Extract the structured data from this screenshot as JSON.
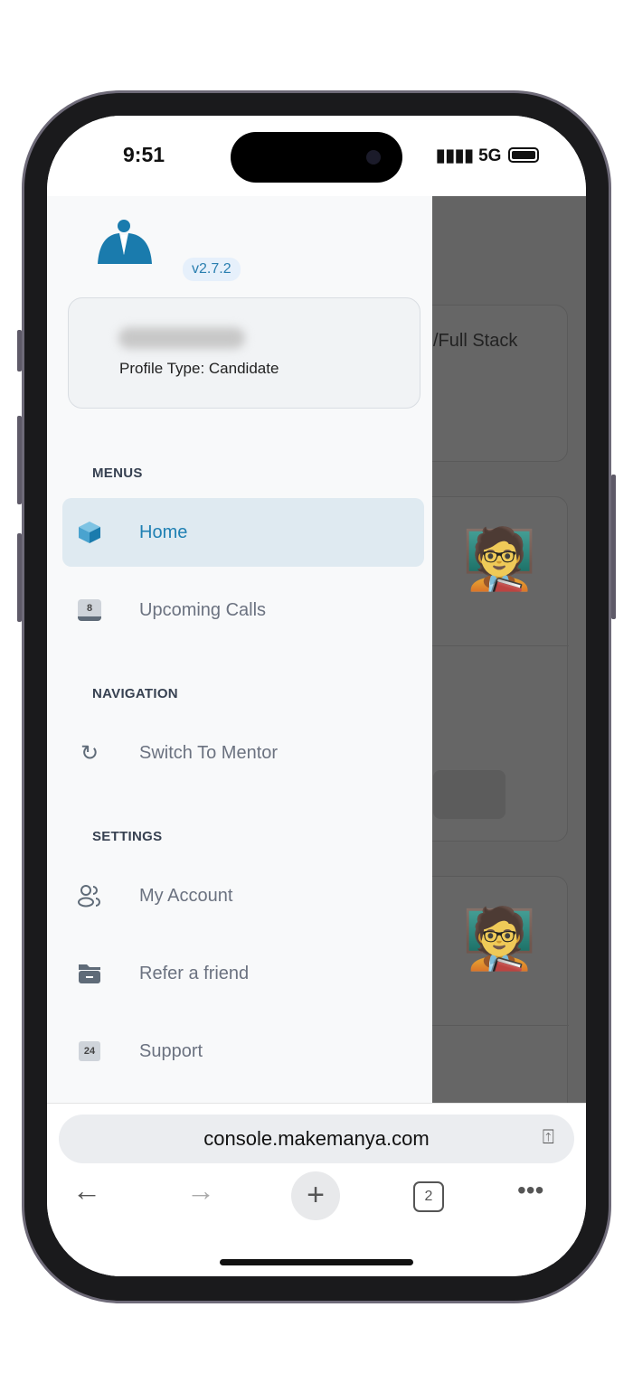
{
  "status_bar": {
    "time": "9:51",
    "signal": "5G"
  },
  "drawer": {
    "version": "v2.7.2",
    "profile_type": "Profile Type: Candidate",
    "sections": {
      "menus": "MENUS",
      "navigation": "NAVIGATION",
      "settings": "SETTINGS"
    },
    "items": [
      {
        "label": "Home",
        "icon": "cube-icon",
        "active": true
      },
      {
        "label": "Upcoming Calls",
        "icon": "calendar-icon",
        "badge": "8"
      },
      {
        "label": "Switch To Mentor",
        "icon": "refresh-icon"
      },
      {
        "label": "My Account",
        "icon": "users-icon"
      },
      {
        "label": "Refer a friend",
        "icon": "folder-icon"
      },
      {
        "label": "Support",
        "icon": "support-24-icon",
        "badge": "24"
      }
    ]
  },
  "background": {
    "card_title_fragment": "/Full Stack"
  },
  "browser": {
    "url": "console.makemanya.com",
    "tab_count": "2"
  },
  "colors": {
    "accent": "#1f80b3",
    "active_bg": "#dfeaf1",
    "overlay": "#646464"
  }
}
